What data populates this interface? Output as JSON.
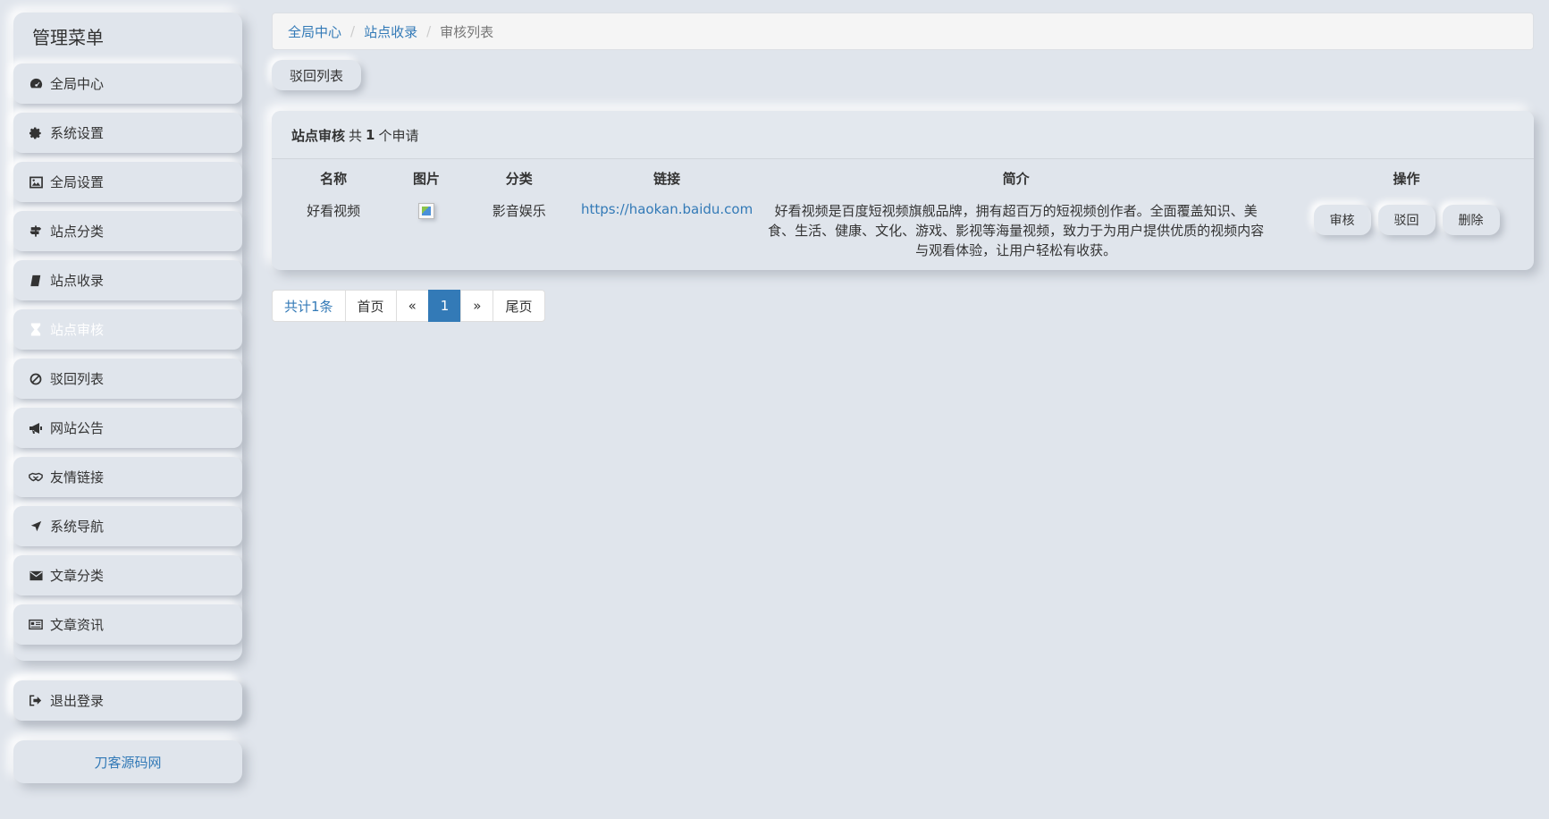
{
  "sidebar": {
    "title": "管理菜单",
    "items": [
      {
        "label": "全局中心",
        "icon": "dashboard-icon"
      },
      {
        "label": "系统设置",
        "icon": "gear-icon"
      },
      {
        "label": "全局设置",
        "icon": "picture-icon"
      },
      {
        "label": "站点分类",
        "icon": "signpost-icon"
      },
      {
        "label": "站点收录",
        "icon": "book-icon"
      },
      {
        "label": "站点审核",
        "icon": "hourglass-icon",
        "active": true
      },
      {
        "label": "驳回列表",
        "icon": "ban-icon"
      },
      {
        "label": "网站公告",
        "icon": "megaphone-icon"
      },
      {
        "label": "友情链接",
        "icon": "handshake-icon"
      },
      {
        "label": "系统导航",
        "icon": "location-arrow-icon"
      },
      {
        "label": "文章分类",
        "icon": "envelope-icon"
      },
      {
        "label": "文章资讯",
        "icon": "newspaper-icon"
      }
    ],
    "logout_label": "退出登录",
    "footer_text": "刀客源码网"
  },
  "breadcrumb": {
    "items": [
      "全局中心",
      "站点收录"
    ],
    "current": "审核列表"
  },
  "reject_list_button": "驳回列表",
  "panel": {
    "title": "站点审核",
    "count_prefix": "共",
    "count": "1",
    "count_suffix": "个申请",
    "columns": [
      "名称",
      "图片",
      "分类",
      "链接",
      "简介",
      "操作"
    ],
    "rows": [
      {
        "name": "好看视频",
        "category": "影音娱乐",
        "link": "https://haokan.baidu.com",
        "description": "好看视频是百度短视频旗舰品牌，拥有超百万的短视频创作者。全面覆盖知识、美食、生活、健康、文化、游戏、影视等海量视频，致力于为用户提供优质的视频内容与观看体验，让用户轻松有收获。",
        "actions": [
          "审核",
          "驳回",
          "删除"
        ]
      }
    ]
  },
  "pagination": {
    "total_label": "共计1条",
    "first_label": "首页",
    "prev_label": "«",
    "current_page": "1",
    "next_label": "»",
    "last_label": "尾页"
  },
  "colors": {
    "background": "#e0e5ec",
    "link": "#337ab7",
    "active_page": "#337ab7"
  }
}
